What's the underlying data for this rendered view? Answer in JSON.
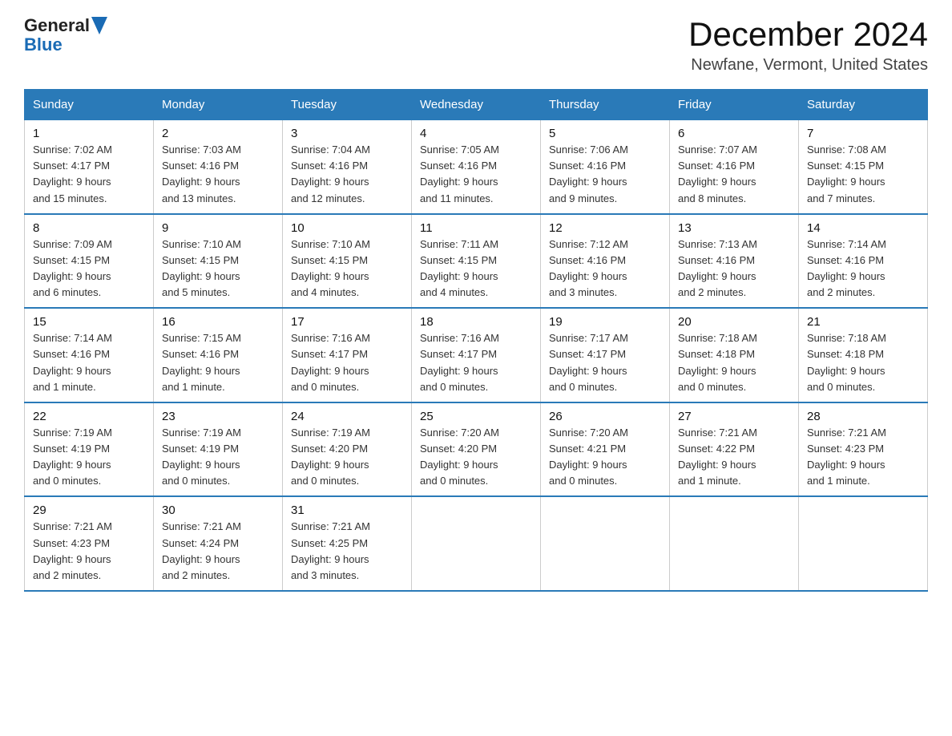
{
  "logo": {
    "general": "General",
    "blue": "Blue"
  },
  "title": "December 2024",
  "subtitle": "Newfane, Vermont, United States",
  "days_of_week": [
    "Sunday",
    "Monday",
    "Tuesday",
    "Wednesday",
    "Thursday",
    "Friday",
    "Saturday"
  ],
  "weeks": [
    [
      {
        "day": "1",
        "info": "Sunrise: 7:02 AM\nSunset: 4:17 PM\nDaylight: 9 hours\nand 15 minutes."
      },
      {
        "day": "2",
        "info": "Sunrise: 7:03 AM\nSunset: 4:16 PM\nDaylight: 9 hours\nand 13 minutes."
      },
      {
        "day": "3",
        "info": "Sunrise: 7:04 AM\nSunset: 4:16 PM\nDaylight: 9 hours\nand 12 minutes."
      },
      {
        "day": "4",
        "info": "Sunrise: 7:05 AM\nSunset: 4:16 PM\nDaylight: 9 hours\nand 11 minutes."
      },
      {
        "day": "5",
        "info": "Sunrise: 7:06 AM\nSunset: 4:16 PM\nDaylight: 9 hours\nand 9 minutes."
      },
      {
        "day": "6",
        "info": "Sunrise: 7:07 AM\nSunset: 4:16 PM\nDaylight: 9 hours\nand 8 minutes."
      },
      {
        "day": "7",
        "info": "Sunrise: 7:08 AM\nSunset: 4:15 PM\nDaylight: 9 hours\nand 7 minutes."
      }
    ],
    [
      {
        "day": "8",
        "info": "Sunrise: 7:09 AM\nSunset: 4:15 PM\nDaylight: 9 hours\nand 6 minutes."
      },
      {
        "day": "9",
        "info": "Sunrise: 7:10 AM\nSunset: 4:15 PM\nDaylight: 9 hours\nand 5 minutes."
      },
      {
        "day": "10",
        "info": "Sunrise: 7:10 AM\nSunset: 4:15 PM\nDaylight: 9 hours\nand 4 minutes."
      },
      {
        "day": "11",
        "info": "Sunrise: 7:11 AM\nSunset: 4:15 PM\nDaylight: 9 hours\nand 4 minutes."
      },
      {
        "day": "12",
        "info": "Sunrise: 7:12 AM\nSunset: 4:16 PM\nDaylight: 9 hours\nand 3 minutes."
      },
      {
        "day": "13",
        "info": "Sunrise: 7:13 AM\nSunset: 4:16 PM\nDaylight: 9 hours\nand 2 minutes."
      },
      {
        "day": "14",
        "info": "Sunrise: 7:14 AM\nSunset: 4:16 PM\nDaylight: 9 hours\nand 2 minutes."
      }
    ],
    [
      {
        "day": "15",
        "info": "Sunrise: 7:14 AM\nSunset: 4:16 PM\nDaylight: 9 hours\nand 1 minute."
      },
      {
        "day": "16",
        "info": "Sunrise: 7:15 AM\nSunset: 4:16 PM\nDaylight: 9 hours\nand 1 minute."
      },
      {
        "day": "17",
        "info": "Sunrise: 7:16 AM\nSunset: 4:17 PM\nDaylight: 9 hours\nand 0 minutes."
      },
      {
        "day": "18",
        "info": "Sunrise: 7:16 AM\nSunset: 4:17 PM\nDaylight: 9 hours\nand 0 minutes."
      },
      {
        "day": "19",
        "info": "Sunrise: 7:17 AM\nSunset: 4:17 PM\nDaylight: 9 hours\nand 0 minutes."
      },
      {
        "day": "20",
        "info": "Sunrise: 7:18 AM\nSunset: 4:18 PM\nDaylight: 9 hours\nand 0 minutes."
      },
      {
        "day": "21",
        "info": "Sunrise: 7:18 AM\nSunset: 4:18 PM\nDaylight: 9 hours\nand 0 minutes."
      }
    ],
    [
      {
        "day": "22",
        "info": "Sunrise: 7:19 AM\nSunset: 4:19 PM\nDaylight: 9 hours\nand 0 minutes."
      },
      {
        "day": "23",
        "info": "Sunrise: 7:19 AM\nSunset: 4:19 PM\nDaylight: 9 hours\nand 0 minutes."
      },
      {
        "day": "24",
        "info": "Sunrise: 7:19 AM\nSunset: 4:20 PM\nDaylight: 9 hours\nand 0 minutes."
      },
      {
        "day": "25",
        "info": "Sunrise: 7:20 AM\nSunset: 4:20 PM\nDaylight: 9 hours\nand 0 minutes."
      },
      {
        "day": "26",
        "info": "Sunrise: 7:20 AM\nSunset: 4:21 PM\nDaylight: 9 hours\nand 0 minutes."
      },
      {
        "day": "27",
        "info": "Sunrise: 7:21 AM\nSunset: 4:22 PM\nDaylight: 9 hours\nand 1 minute."
      },
      {
        "day": "28",
        "info": "Sunrise: 7:21 AM\nSunset: 4:23 PM\nDaylight: 9 hours\nand 1 minute."
      }
    ],
    [
      {
        "day": "29",
        "info": "Sunrise: 7:21 AM\nSunset: 4:23 PM\nDaylight: 9 hours\nand 2 minutes."
      },
      {
        "day": "30",
        "info": "Sunrise: 7:21 AM\nSunset: 4:24 PM\nDaylight: 9 hours\nand 2 minutes."
      },
      {
        "day": "31",
        "info": "Sunrise: 7:21 AM\nSunset: 4:25 PM\nDaylight: 9 hours\nand 3 minutes."
      },
      {
        "day": "",
        "info": ""
      },
      {
        "day": "",
        "info": ""
      },
      {
        "day": "",
        "info": ""
      },
      {
        "day": "",
        "info": ""
      }
    ]
  ]
}
